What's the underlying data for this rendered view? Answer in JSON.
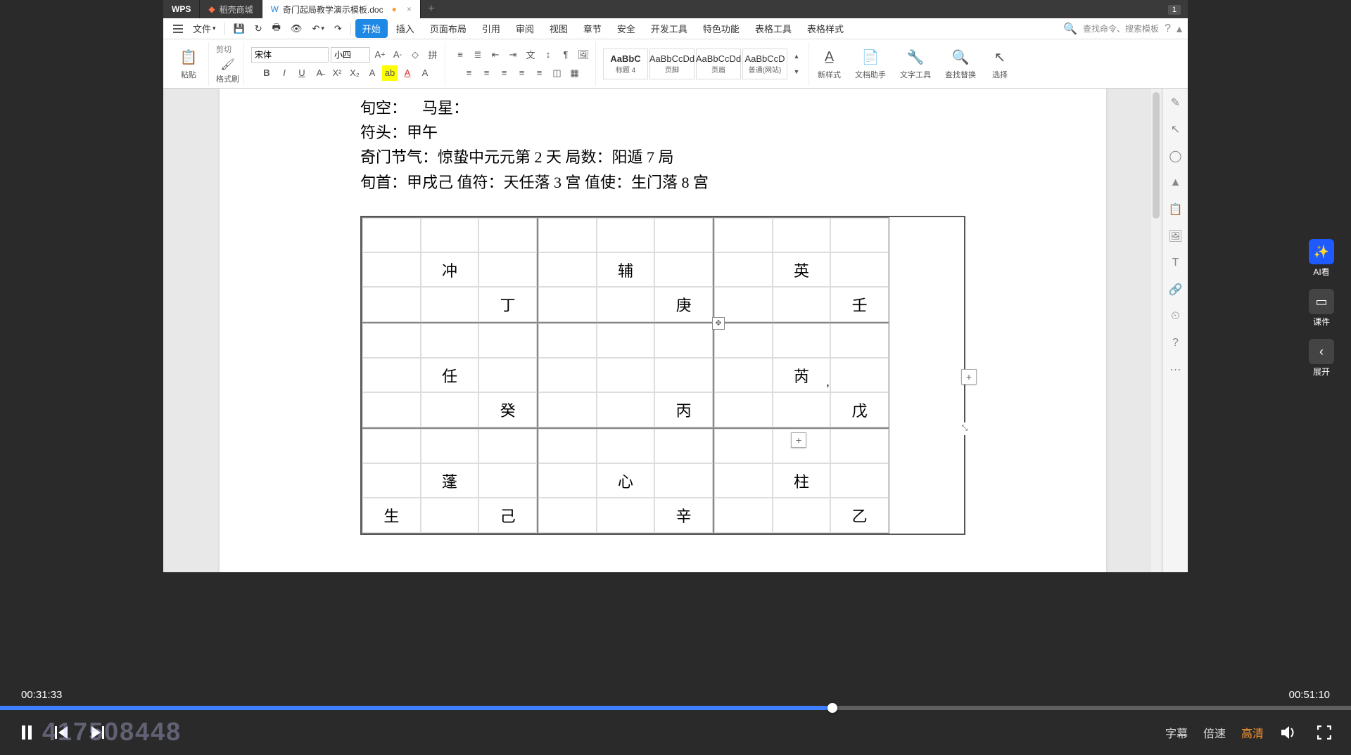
{
  "tabs": {
    "wps": "WPS",
    "store": "稻壳商城",
    "doc": "奇门起局教学演示模板.doc",
    "indicator": "1"
  },
  "menu": {
    "file": "文件",
    "search": "查找命令、搜索模板",
    "ribbon": [
      "开始",
      "插入",
      "页面布局",
      "引用",
      "审阅",
      "视图",
      "章节",
      "安全",
      "开发工具",
      "特色功能",
      "表格工具",
      "表格样式"
    ]
  },
  "toolbar": {
    "paste": "粘贴",
    "cut": "剪切",
    "format_brush": "格式刷",
    "font_name": "宋体",
    "font_size": "小四",
    "styles": [
      {
        "preview": "AaBbC",
        "name": "标题 4"
      },
      {
        "preview": "AaBbCcDd",
        "name": "页脚"
      },
      {
        "preview": "AaBbCcDd",
        "name": "页眉"
      },
      {
        "preview": "AaBbCcD",
        "name": "普通(网站)"
      }
    ],
    "new_style": "新样式",
    "doc_assist": "文档助手",
    "text_tools": "文字工具",
    "find_replace": "查找替换",
    "select": "选择"
  },
  "document": {
    "line1_a": "旬空：",
    "line1_b": "马星：",
    "line2": "符头：甲午",
    "line3": "奇门节气：惊蛰中元元第 2 天   局数：阳遁 7 局",
    "line4": "旬首：甲戌己   值符：天任落 3 宫   值使：生门落 8 宫",
    "grid": [
      [
        {
          "mid": "冲",
          "br": "丁"
        },
        {
          "mid": "辅",
          "br": "庚"
        },
        {
          "mid": "英",
          "br": "壬"
        }
      ],
      [
        {
          "mid": "任",
          "br": "癸"
        },
        {
          "mid": "",
          "br": "丙"
        },
        {
          "mid": "芮",
          "br": "戊"
        }
      ],
      [
        {
          "mid": "蓬",
          "bl": "生",
          "br": "己"
        },
        {
          "mid": "心",
          "br": "辛"
        },
        {
          "mid": "柱",
          "br": "乙"
        }
      ]
    ]
  },
  "float": {
    "ai": "AI看",
    "courseware": "课件",
    "expand": "展开"
  },
  "player": {
    "current": "00:31:33",
    "total": "00:51:10",
    "subtitle": "字幕",
    "speed": "倍速",
    "quality": "高清",
    "watermark": "417508448"
  }
}
